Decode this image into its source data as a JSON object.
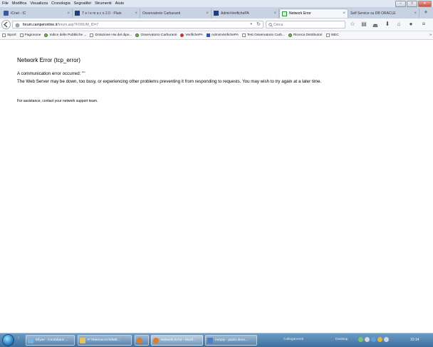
{
  "menubar": {
    "items": [
      "File",
      "Modifica",
      "Visualizza",
      "Cronologia",
      "Segnalibri",
      "Strumenti",
      "Aiuto"
    ]
  },
  "tabs": [
    {
      "label": "ICnet - IC",
      "active": false
    },
    {
      "label": "T e l e m a c o 2.0 - Plain",
      "active": false
    },
    {
      "label": "Osservatorio Carburanti",
      "active": false
    },
    {
      "label": "AdminVerifichePA",
      "active": false
    },
    {
      "label": "Network Error",
      "active": true
    },
    {
      "label": "Self Service su DB ORACLE",
      "active": false
    }
  ],
  "navbar": {
    "url_domain": "forum.camperonline.it",
    "url_path": "/forum.asp?FORUM_ID=7",
    "search_placeholder": "Cerca"
  },
  "bookmarks": [
    {
      "label": "Siport"
    },
    {
      "label": "Pagionone"
    },
    {
      "label": "Indice delle Pubbliche ..."
    },
    {
      "label": "Dotazione Hw del dipe..."
    },
    {
      "label": "Osservatorio Carburanti"
    },
    {
      "label": "VerifichePA"
    },
    {
      "label": "AdminVerifichePA"
    },
    {
      "label": "Test Osservatorio Carb..."
    },
    {
      "label": "Ricerca Distributori"
    },
    {
      "label": "ISEC"
    }
  ],
  "content": {
    "title": "Network Error (tcp_error)",
    "line1": "A communication error occurred: \"\"",
    "line2": "The Web Server may be down, too busy, or experiencing other problems preventing it from responding to requests. You may wish to try again at a later time.",
    "line3": "For assistance, contact your network support team."
  },
  "taskbar": {
    "tasks": [
      {
        "label": "Ellyse - Contattami ..."
      },
      {
        "label": "P:\\Telemaco\\AMME..."
      },
      {
        "label": ""
      },
      {
        "label": "Network Error - Mozil..."
      },
      {
        "label": "mmpiy - paolo.dezo..."
      }
    ],
    "tray_collegamenti": "Collegamenti",
    "tray_desktop": "Desktop",
    "clock": "10:14"
  },
  "colors": {
    "accent": "#3e6f9c",
    "tab_strip": "#c7d3e3",
    "menubar": "#dfe7f2"
  }
}
